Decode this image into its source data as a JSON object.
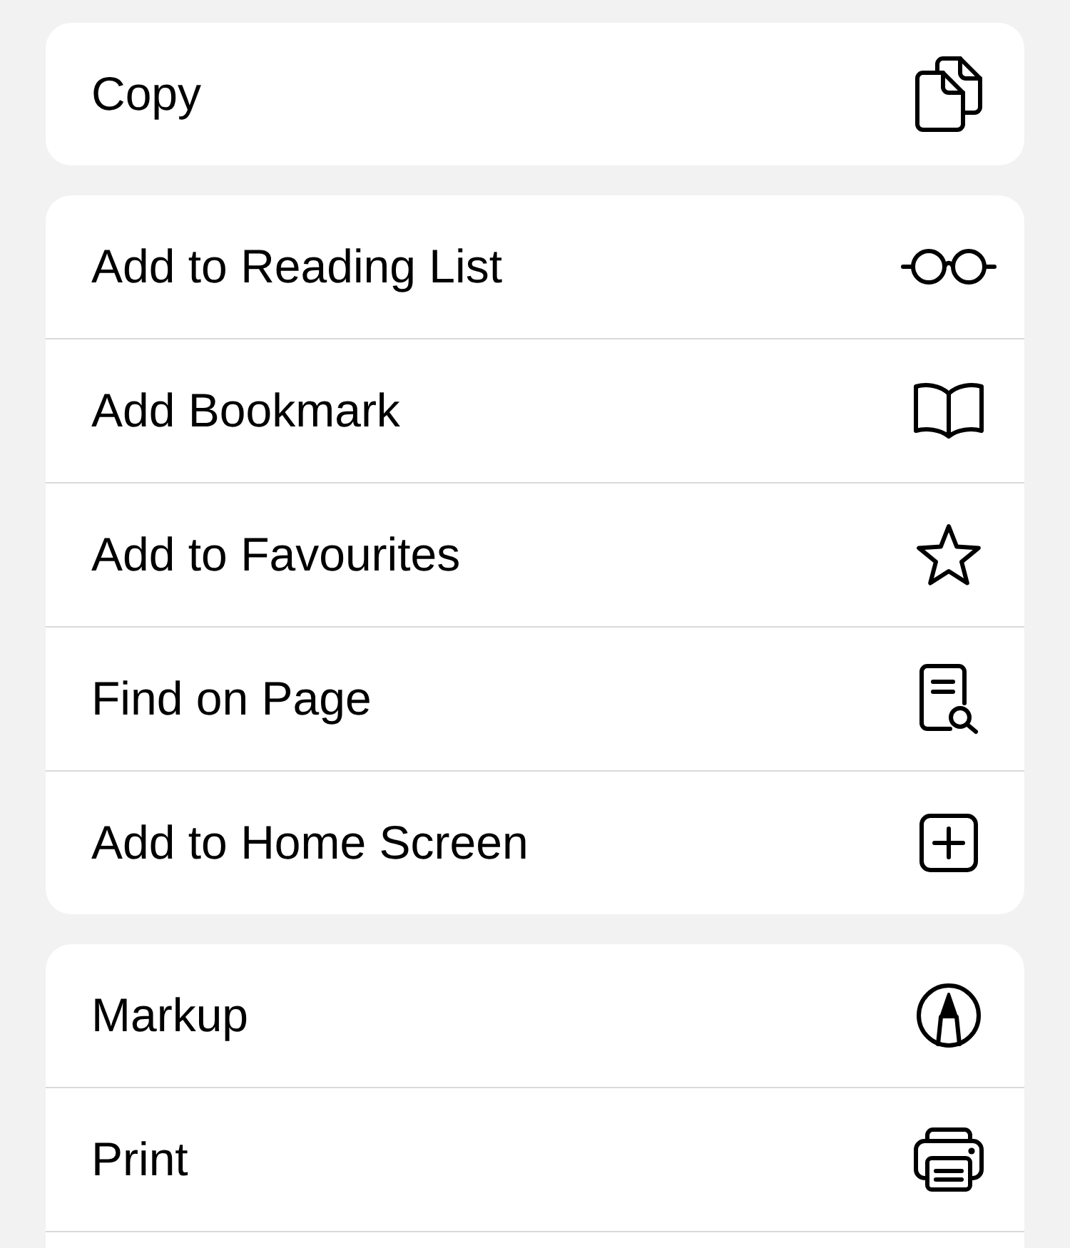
{
  "groups": [
    {
      "items": [
        {
          "label": "Copy",
          "kind": "copy"
        }
      ]
    },
    {
      "items": [
        {
          "label": "Add to Reading List",
          "kind": "glasses"
        },
        {
          "label": "Add Bookmark",
          "kind": "book"
        },
        {
          "label": "Add to Favourites",
          "kind": "star"
        },
        {
          "label": "Find on Page",
          "kind": "find"
        },
        {
          "label": "Add to Home Screen",
          "kind": "addsquare"
        }
      ]
    },
    {
      "items": [
        {
          "label": "Markup",
          "kind": "markup"
        },
        {
          "label": "Print",
          "kind": "printer"
        }
      ]
    }
  ]
}
